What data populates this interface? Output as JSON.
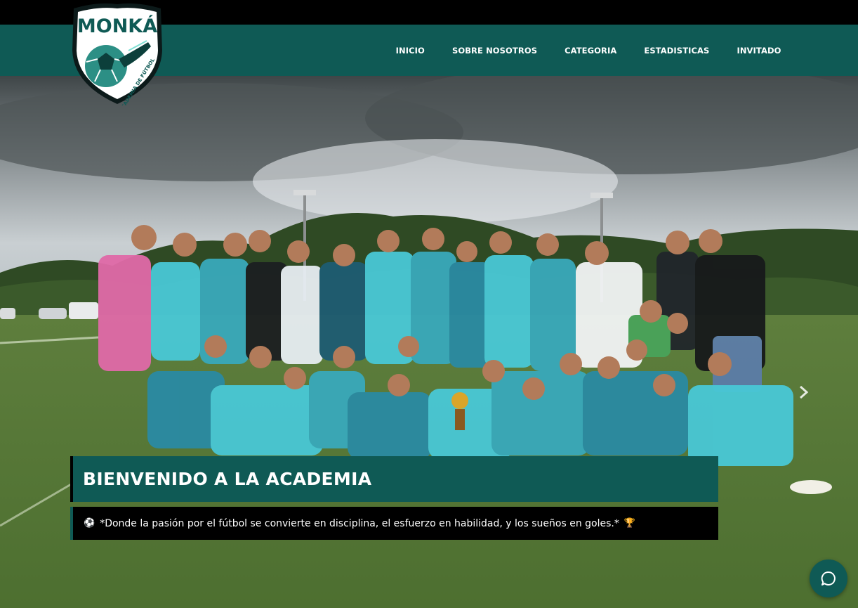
{
  "header": {
    "logo": {
      "name": "MONKÁ",
      "subtitle": "ACADEMIA DE FÚTBOL",
      "icon": "soccer-ball-with-cleat"
    },
    "nav": [
      {
        "label": "INICIO"
      },
      {
        "label": "SOBRE NOSOTROS"
      },
      {
        "label": "CATEGORIA"
      },
      {
        "label": "ESTADISTICAS"
      },
      {
        "label": "INVITADO"
      }
    ]
  },
  "hero": {
    "image_description_icon": "team-photo",
    "title": "BIENVENIDO A LA ACADEMIA",
    "tagline_icon_left": "soccer-ball-emoji",
    "tagline": "*Donde la pasión por el fútbol se convierte en disciplina, el esfuerzo en habilidad, y los sueños en goles.*",
    "tagline_icon_right": "trophy-emoji",
    "next_icon": "chevron-right-icon"
  },
  "chat": {
    "icon": "chat-bubble-icon"
  },
  "colors": {
    "brand": "#0f5a55",
    "topbar": "#000000",
    "text": "#ffffff"
  }
}
